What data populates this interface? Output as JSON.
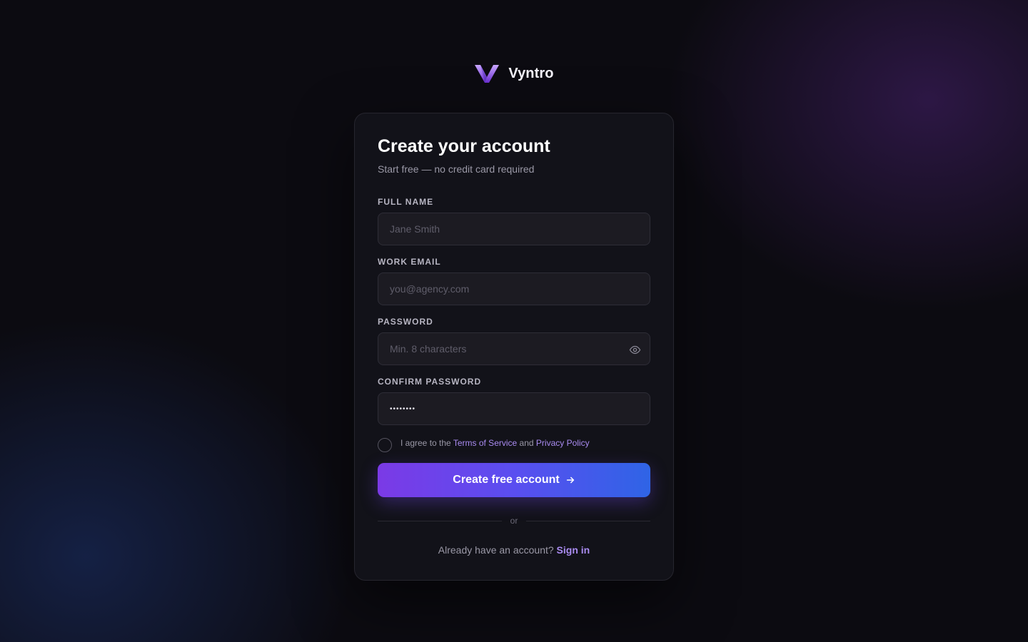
{
  "brand": {
    "name": "Vyntro",
    "logo": "v-chevron-logo"
  },
  "form": {
    "title": "Create your account",
    "subtitle": "Start free — no credit card required",
    "full_name": {
      "label": "FULL NAME",
      "placeholder": "Jane Smith",
      "value": ""
    },
    "work_email": {
      "label": "WORK EMAIL",
      "placeholder": "you@agency.com",
      "value": ""
    },
    "password": {
      "label": "PASSWORD",
      "placeholder": "Min. 8 characters",
      "value": "",
      "toggle_icon": "eye-icon"
    },
    "confirm_password": {
      "label": "CONFIRM PASSWORD",
      "placeholder": "",
      "value": "••••••••"
    },
    "agree": {
      "prefix": "I agree to the ",
      "terms_label": "Terms of Service",
      "conjunction": " and ",
      "privacy_label": "Privacy Policy",
      "checked": false
    },
    "submit_label": "Create free account",
    "submit_icon": "arrow-right-icon",
    "divider_text": "or",
    "signin_prompt": "Already have an account?",
    "signin_label": "Sign in"
  },
  "colors": {
    "accent": "#a98bf0",
    "button_gradient_start": "#7b3ae6",
    "button_gradient_end": "#2f64e6",
    "background": "#0c0b11",
    "card": "#14131a"
  }
}
